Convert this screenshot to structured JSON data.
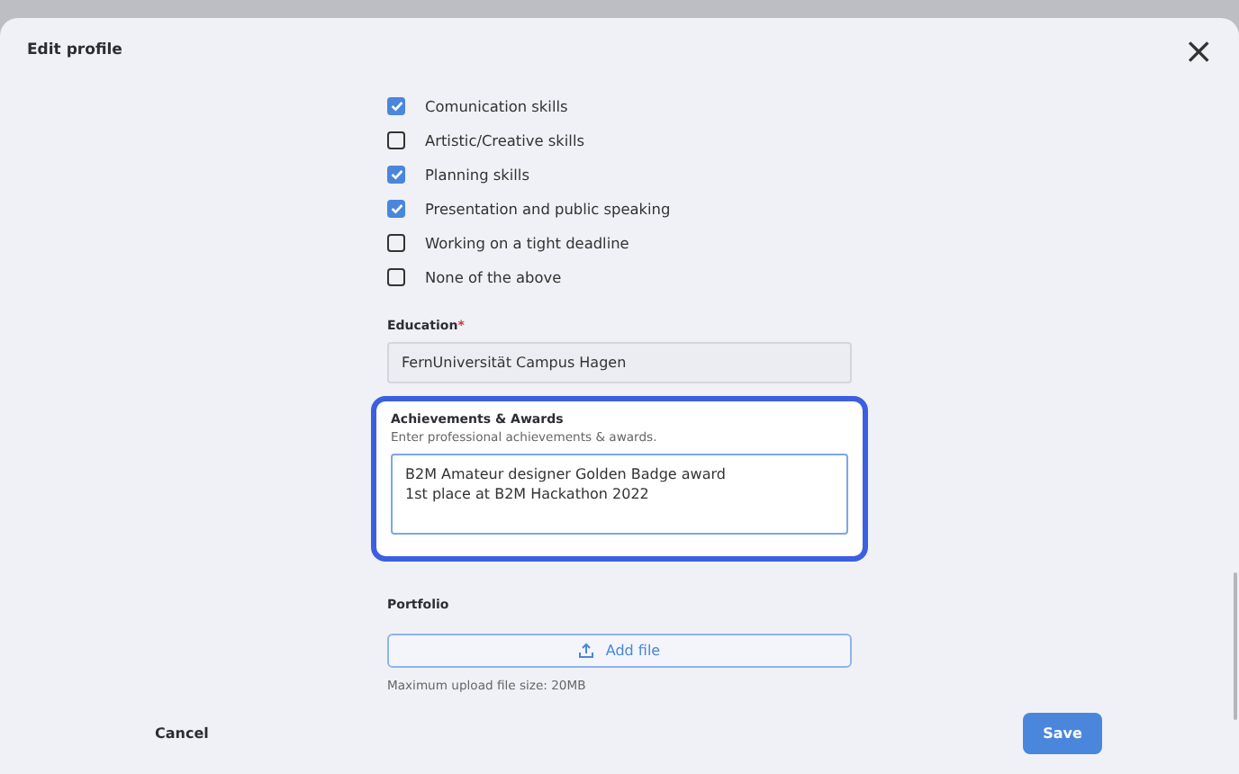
{
  "dialog": {
    "title": "Edit profile",
    "close": "×"
  },
  "skills": [
    {
      "label": "Comunication skills",
      "checked": true
    },
    {
      "label": "Artistic/Creative skills",
      "checked": false
    },
    {
      "label": "Planning skills",
      "checked": true
    },
    {
      "label": "Presentation and public speaking",
      "checked": true
    },
    {
      "label": "Working on a tight deadline",
      "checked": false
    },
    {
      "label": "None of the above",
      "checked": false
    }
  ],
  "education": {
    "label": "Education",
    "required_mark": "*",
    "value": "FernUniversität Campus Hagen"
  },
  "achievements": {
    "label": "Achievements & Awards",
    "hint": "Enter professional achievements & awards.",
    "value": "B2M Amateur designer Golden Badge award\n1st place at B2M Hackathon 2022",
    "focused": true
  },
  "portfolio": {
    "label": "Portfolio",
    "button": "Add file",
    "note": "Maximum upload file size: 20MB"
  },
  "footer": {
    "cancel": "Cancel",
    "save": "Save"
  }
}
